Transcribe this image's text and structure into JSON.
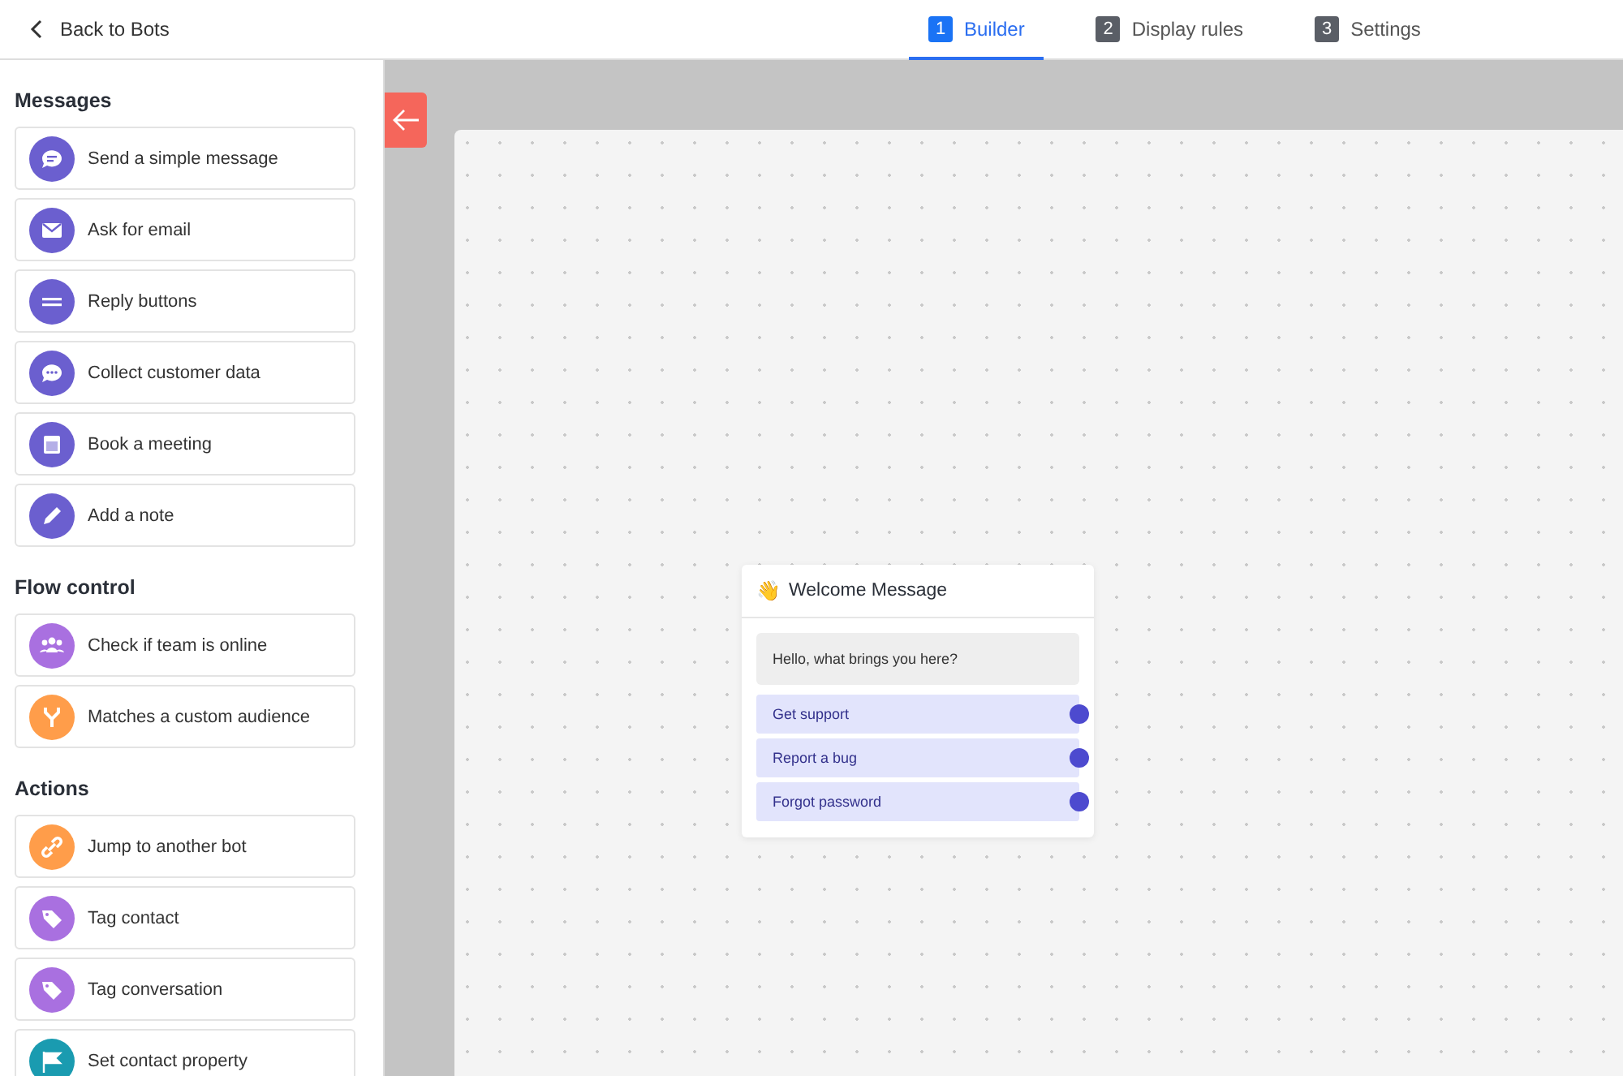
{
  "header": {
    "back_link": "Back to Bots",
    "tabs": [
      {
        "number": "1",
        "label": "Builder",
        "selected": true
      },
      {
        "number": "2",
        "label": "Display rules",
        "selected": false
      },
      {
        "number": "3",
        "label": "Settings",
        "selected": false
      }
    ]
  },
  "sidebar": {
    "sections": [
      {
        "title": "Messages",
        "items": [
          {
            "label": "Send a simple message",
            "color": "#6b5fcf"
          },
          {
            "label": "Ask for email",
            "color": "#6b5fcf"
          },
          {
            "label": "Reply buttons",
            "color": "#6b5fcf"
          },
          {
            "label": "Collect customer data",
            "color": "#6b5fcf"
          },
          {
            "label": "Book a meeting",
            "color": "#6b5fcf"
          },
          {
            "label": "Add a note",
            "color": "#6b5fcf"
          }
        ]
      },
      {
        "title": "Flow control",
        "items": [
          {
            "label": "Check if team is online",
            "color": "#a970e0"
          },
          {
            "label": "Matches a custom audience",
            "color": "#ff9d4a"
          }
        ]
      },
      {
        "title": "Actions",
        "items": [
          {
            "label": "Jump to another bot",
            "color": "#ff9d4a"
          },
          {
            "label": "Tag contact",
            "color": "#a970e0"
          },
          {
            "label": "Tag conversation",
            "color": "#a970e0"
          },
          {
            "label": "Set contact property",
            "color": "#1a9bb0"
          }
        ]
      }
    ]
  },
  "canvas": {
    "node": {
      "emoji": "👋",
      "title": "Welcome Message",
      "message": "Hello, what brings you here?",
      "replies": [
        "Get support",
        "Report a bug",
        "Forgot password"
      ]
    }
  }
}
